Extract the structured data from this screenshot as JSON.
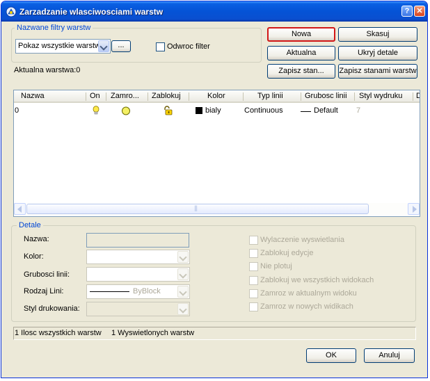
{
  "window": {
    "title": "Zarzadzanie wlasciwosciami warstw",
    "help_label": "?",
    "close_label": "✕"
  },
  "filters": {
    "legend": "Nazwane filtry warstw",
    "selected": "Pokaz wszystkie warstw",
    "browse_label": "...",
    "invert_label": "Odwroc filter"
  },
  "current_layer_label": "Aktualna warstwa:0",
  "buttons": {
    "new": "Nowa",
    "delete": "Skasuj",
    "current": "Aktualna",
    "hide_details": "Ukryj detale",
    "save_state": "Zapisz stan...",
    "states": "Zapisz stanami warstw",
    "ok": "OK",
    "cancel": "Anuluj"
  },
  "table": {
    "columns": [
      "Nazwa",
      "On",
      "Zamro...",
      "Zablokuj",
      "Kolor",
      "Typ linii",
      "Grubosc linii",
      "Styl wydruku",
      "D"
    ],
    "rows": [
      {
        "name": "0",
        "on": "bulb-icon",
        "freeze": "sun-icon",
        "lock": "lock-icon",
        "color_swatch": "#000000",
        "color": "bialy",
        "linetype": "Continuous",
        "lineweight": "Default",
        "plotstyle": "7"
      }
    ],
    "scroll_grip": "|||"
  },
  "details": {
    "legend": "Detale",
    "name_label": "Nazwa:",
    "color_label": "Kolor:",
    "lineweight_label": "Grubosci linii:",
    "linetype_label": "Rodzaj Lini:",
    "linetype_value": "ByBlock",
    "plotstyle_label": "Styl drukowania:",
    "checkboxes": [
      "Wylaczenie wyswietlania",
      "Zablokuj edycje",
      "Nie plotuj",
      "Zablokuj we wszystkich widokach",
      "Zamroz w aktualnym widoku",
      "Zamroz w nowych widikach"
    ]
  },
  "status": {
    "total": "1 Ilosc wszystkich warstw",
    "displayed": "1 Wyswietlonych warstw"
  },
  "colors": {
    "title_bar": "#0553d6",
    "dialog_bg": "#ece9d8",
    "default_button_border": "#d21717",
    "group_label": "#0046d5"
  }
}
